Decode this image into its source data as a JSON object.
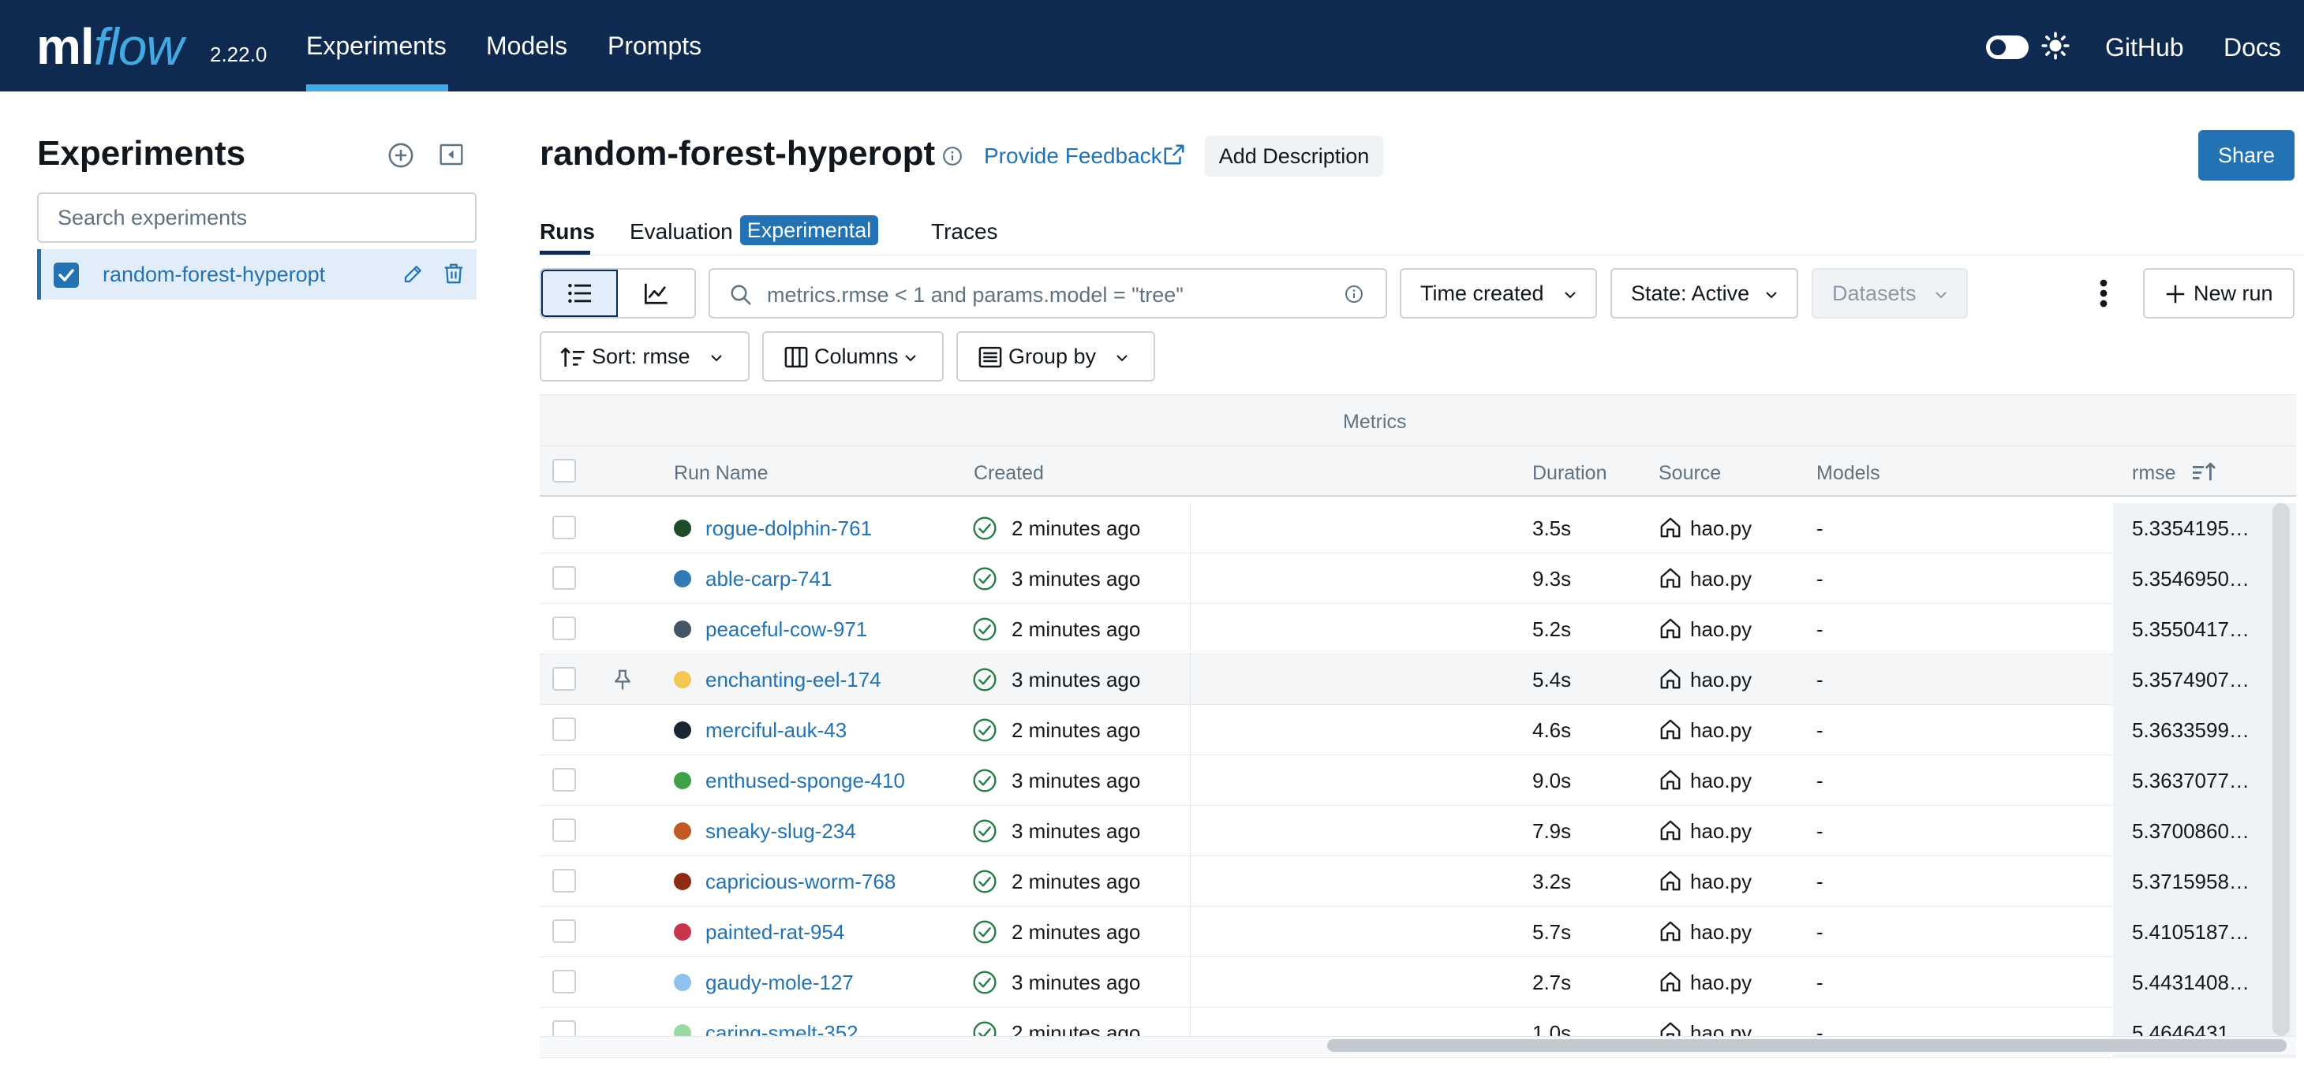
{
  "header": {
    "logo_ml": "ml",
    "logo_flow": "flow",
    "version": "2.22.0",
    "nav": [
      {
        "label": "Experiments",
        "active": true
      },
      {
        "label": "Models",
        "active": false
      },
      {
        "label": "Prompts",
        "active": false
      }
    ],
    "github": "GitHub",
    "docs": "Docs",
    "brand_color": "#0e2a51",
    "accent_color": "#43a9e2"
  },
  "sidebar": {
    "title": "Experiments",
    "search_placeholder": "Search experiments",
    "experiments": [
      {
        "name": "random-forest-hyperopt",
        "checked": true
      }
    ]
  },
  "main": {
    "title": "random-forest-hyperopt",
    "feedback": "Provide Feedback",
    "add_description": "Add Description",
    "share": "Share",
    "tabs": [
      {
        "label": "Runs",
        "active": true
      },
      {
        "label": "Evaluation",
        "active": false
      },
      {
        "label": "Traces",
        "active": false
      }
    ],
    "badge": "Experimental",
    "filter_placeholder": "metrics.rmse < 1 and params.model = \"tree\"",
    "time_created": "Time created",
    "state": "State: Active",
    "datasets": "Datasets",
    "new_run": "New run",
    "sort": "Sort: rmse",
    "columns": "Columns",
    "group_by": "Group by"
  },
  "table": {
    "group_header": "Metrics",
    "columns": {
      "run_name": "Run Name",
      "created": "Created",
      "duration": "Duration",
      "source": "Source",
      "models": "Models",
      "rmse": "rmse"
    },
    "rows": [
      {
        "name": "rogue-dolphin-761",
        "color": "#1f4d2b",
        "created": "2 minutes ago",
        "duration": "3.5s",
        "source": "hao.py",
        "models": "-",
        "rmse": "5.3354195…",
        "pinned": false
      },
      {
        "name": "able-carp-741",
        "color": "#2e7bb8",
        "created": "3 minutes ago",
        "duration": "9.3s",
        "source": "hao.py",
        "models": "-",
        "rmse": "5.3546950…",
        "pinned": false
      },
      {
        "name": "peaceful-cow-971",
        "color": "#445566",
        "created": "2 minutes ago",
        "duration": "5.2s",
        "source": "hao.py",
        "models": "-",
        "rmse": "5.3550417…",
        "pinned": false
      },
      {
        "name": "enchanting-eel-174",
        "color": "#f4c653",
        "created": "3 minutes ago",
        "duration": "5.4s",
        "source": "hao.py",
        "models": "-",
        "rmse": "5.3574907…",
        "pinned": true
      },
      {
        "name": "merciful-auk-43",
        "color": "#1c2630",
        "created": "2 minutes ago",
        "duration": "4.6s",
        "source": "hao.py",
        "models": "-",
        "rmse": "5.3633599…",
        "pinned": false
      },
      {
        "name": "enthused-sponge-410",
        "color": "#3fa14a",
        "created": "3 minutes ago",
        "duration": "9.0s",
        "source": "hao.py",
        "models": "-",
        "rmse": "5.3637077…",
        "pinned": false
      },
      {
        "name": "sneaky-slug-234",
        "color": "#c05a24",
        "created": "3 minutes ago",
        "duration": "7.9s",
        "source": "hao.py",
        "models": "-",
        "rmse": "5.3700860…",
        "pinned": false
      },
      {
        "name": "capricious-worm-768",
        "color": "#8f2a16",
        "created": "2 minutes ago",
        "duration": "3.2s",
        "source": "hao.py",
        "models": "-",
        "rmse": "5.3715958…",
        "pinned": false
      },
      {
        "name": "painted-rat-954",
        "color": "#c8364b",
        "created": "2 minutes ago",
        "duration": "5.7s",
        "source": "hao.py",
        "models": "-",
        "rmse": "5.4105187…",
        "pinned": false
      },
      {
        "name": "gaudy-mole-127",
        "color": "#8fc0ee",
        "created": "3 minutes ago",
        "duration": "2.7s",
        "source": "hao.py",
        "models": "-",
        "rmse": "5.4431408…",
        "pinned": false
      },
      {
        "name": "caring-smelt-352",
        "color": "#9ad9a6",
        "created": "2 minutes ago",
        "duration": "1.0s",
        "source": "hao.py",
        "models": "-",
        "rmse": "5.4646431…",
        "pinned": false
      }
    ]
  }
}
